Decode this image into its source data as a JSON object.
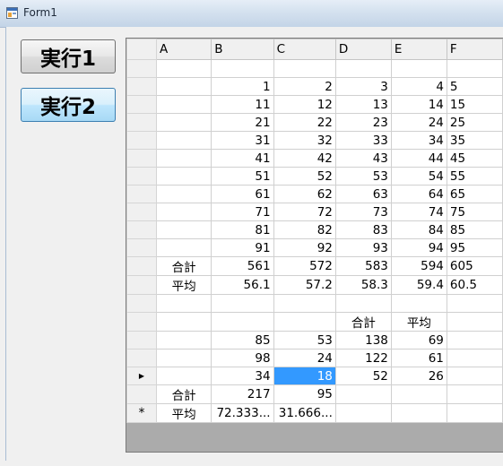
{
  "window": {
    "title": "Form1"
  },
  "buttons": {
    "run1": "実行1",
    "run2": "実行2"
  },
  "grid": {
    "columns": [
      "A",
      "B",
      "C",
      "D",
      "E",
      "F"
    ],
    "row_markers": {
      "current": "▶",
      "new": "*"
    },
    "rows": [
      [
        "",
        "",
        "",
        "",
        "",
        ""
      ],
      [
        "",
        "1",
        "2",
        "3",
        "4",
        "5"
      ],
      [
        "",
        "11",
        "12",
        "13",
        "14",
        "15"
      ],
      [
        "",
        "21",
        "22",
        "23",
        "24",
        "25"
      ],
      [
        "",
        "31",
        "32",
        "33",
        "34",
        "35"
      ],
      [
        "",
        "41",
        "42",
        "43",
        "44",
        "45"
      ],
      [
        "",
        "51",
        "52",
        "53",
        "54",
        "55"
      ],
      [
        "",
        "61",
        "62",
        "63",
        "64",
        "65"
      ],
      [
        "",
        "71",
        "72",
        "73",
        "74",
        "75"
      ],
      [
        "",
        "81",
        "82",
        "83",
        "84",
        "85"
      ],
      [
        "",
        "91",
        "92",
        "93",
        "94",
        "95"
      ],
      [
        "合計",
        "561",
        "572",
        "583",
        "594",
        "605"
      ],
      [
        "平均",
        "56.1",
        "57.2",
        "58.3",
        "59.4",
        "60.5"
      ],
      [
        "",
        "",
        "",
        "",
        "",
        ""
      ],
      [
        "",
        "",
        "",
        "合計",
        "平均",
        ""
      ],
      [
        "",
        "85",
        "53",
        "138",
        "69",
        ""
      ],
      [
        "",
        "98",
        "24",
        "122",
        "61",
        ""
      ],
      [
        "",
        "34",
        "18",
        "52",
        "26",
        ""
      ],
      [
        "合計",
        "217",
        "95",
        "",
        "",
        ""
      ],
      [
        "平均",
        "72.333...",
        "31.666...",
        "",
        "",
        ""
      ]
    ]
  },
  "colors": {
    "selection": "#3399ff"
  }
}
